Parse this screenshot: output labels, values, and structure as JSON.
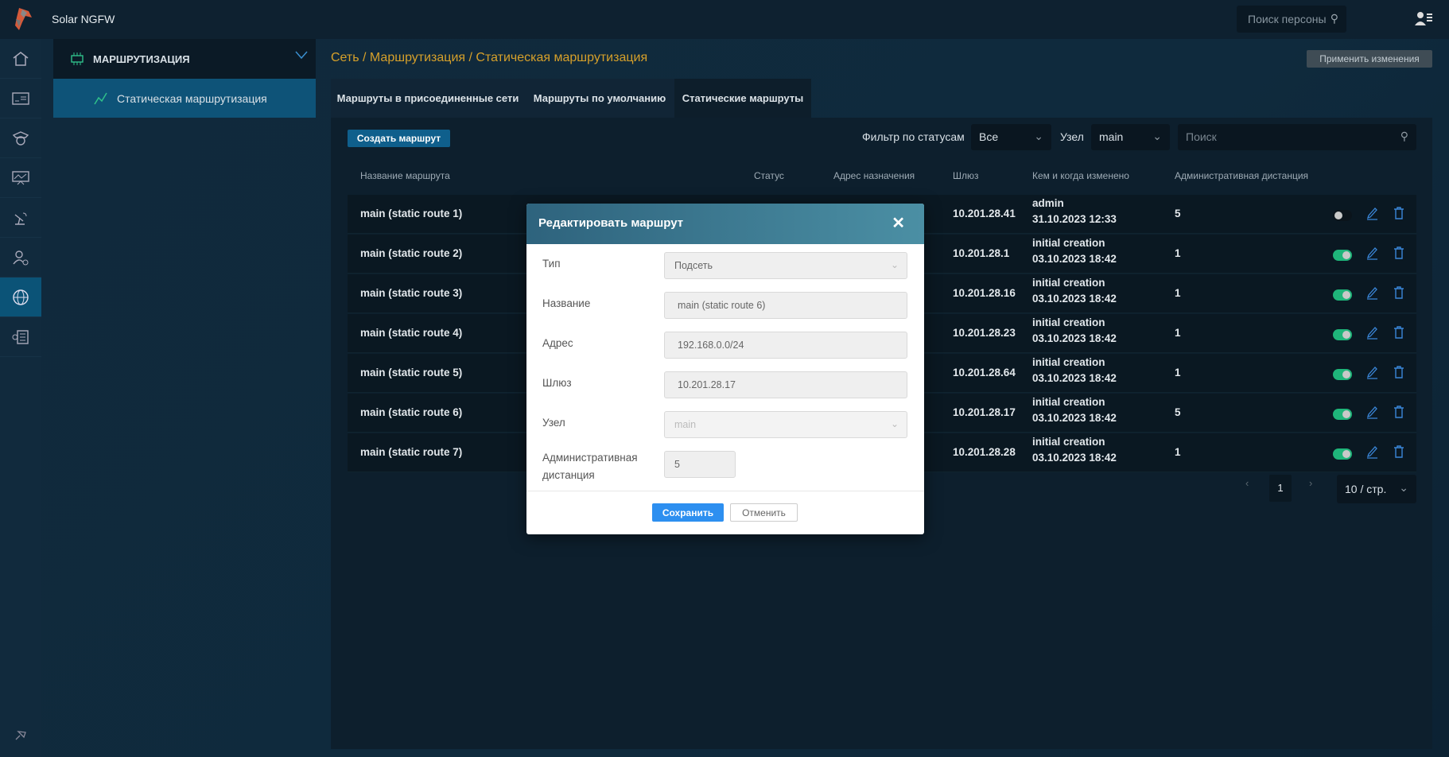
{
  "app": {
    "title": "Solar NGFW",
    "person_search_placeholder": "Поиск персоны"
  },
  "rail": [
    "home",
    "contacts",
    "police",
    "monitoring",
    "satellite",
    "user-settings",
    "network",
    "settings-list"
  ],
  "submenu": {
    "header": "МАРШРУТИЗАЦИЯ",
    "active_item": "Статическая маршрутизация"
  },
  "breadcrumb": "Сеть / Маршрутизация / Статическая маршрутизация",
  "apply_label": "Применить изменения",
  "tabs": [
    {
      "label": "Маршруты в присоединенные сети"
    },
    {
      "label": "Маршруты по умолчанию"
    },
    {
      "label": "Статические маршруты"
    }
  ],
  "toolbar": {
    "create_label": "Создать маршрут",
    "status_filter_label": "Фильтр по статусам",
    "status_value": "Все",
    "node_label": "Узел",
    "node_value": "main",
    "search_placeholder": "Поиск"
  },
  "columns": [
    "Название маршрута",
    "Статус",
    "Адрес назначения",
    "Шлюз",
    "Кем и когда изменено",
    "Административная дистанция"
  ],
  "rows": [
    {
      "name": "main (static route 1)",
      "gateway": "10.201.28.41",
      "who": "admin",
      "when": "31.10.2023 12:33",
      "distance": "5",
      "enabled": false
    },
    {
      "name": "main (static route 2)",
      "gateway": "10.201.28.1",
      "who": "initial creation",
      "when": "03.10.2023 18:42",
      "distance": "1",
      "enabled": true
    },
    {
      "name": "main (static route 3)",
      "gateway": "10.201.28.16",
      "who": "initial creation",
      "when": "03.10.2023 18:42",
      "distance": "1",
      "enabled": true
    },
    {
      "name": "main (static route 4)",
      "gateway": "10.201.28.23",
      "who": "initial creation",
      "when": "03.10.2023 18:42",
      "distance": "1",
      "enabled": true
    },
    {
      "name": "main (static route 5)",
      "gateway": "10.201.28.64",
      "who": "initial creation",
      "when": "03.10.2023 18:42",
      "distance": "1",
      "enabled": true
    },
    {
      "name": "main (static route 6)",
      "gateway": "10.201.28.17",
      "who": "initial creation",
      "when": "03.10.2023 18:42",
      "distance": "5",
      "enabled": true
    },
    {
      "name": "main (static route 7)",
      "gateway": "10.201.28.28",
      "who": "initial creation",
      "when": "03.10.2023 18:42",
      "distance": "1",
      "enabled": true
    }
  ],
  "pagination": {
    "current": "1",
    "page_size": "10 / стр."
  },
  "modal": {
    "title": "Редактировать маршрут",
    "fields": [
      {
        "label": "Тип",
        "value": "Подсеть"
      },
      {
        "label": "Название",
        "value": "main (static route 6)"
      },
      {
        "label": "Адрес",
        "value": "192.168.0.0/24"
      },
      {
        "label": "Шлюз",
        "value": "10.201.28.17"
      },
      {
        "label": "Узел",
        "value": "main"
      },
      {
        "label": "Административная дистанция",
        "value": "5"
      }
    ],
    "save_label": "Сохранить",
    "cancel_label": "Отменить"
  },
  "colors": {
    "accent": "#d6a02a",
    "toggle_on": "#1fb57a",
    "primary": "#2d8ff0"
  }
}
